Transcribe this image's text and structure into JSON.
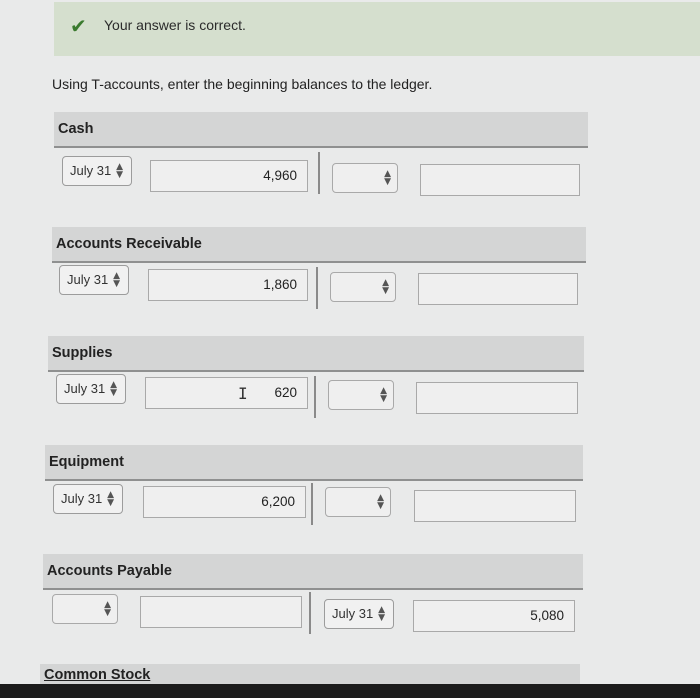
{
  "banner": {
    "check_icon": "checkmark-icon",
    "message": "Your answer is correct."
  },
  "instruction": "Using T-accounts, enter the beginning balances to the ledger.",
  "arrow_glyph": "▲▼",
  "accounts": [
    {
      "name": "Cash",
      "debit_date": "July 31",
      "debit_amount": "4,960",
      "credit_date": "",
      "credit_amount": ""
    },
    {
      "name": "Accounts Receivable",
      "debit_date": "July 31",
      "debit_amount": "1,860",
      "credit_date": "",
      "credit_amount": ""
    },
    {
      "name": "Supplies",
      "debit_date": "July 31",
      "debit_amount": "620",
      "credit_date": "",
      "credit_amount": ""
    },
    {
      "name": "Equipment",
      "debit_date": "July 31",
      "debit_amount": "6,200",
      "credit_date": "",
      "credit_amount": ""
    },
    {
      "name": "Accounts Payable",
      "debit_date": "",
      "debit_amount": "",
      "credit_date": "July 31",
      "credit_amount": "5,080"
    },
    {
      "name": "Common Stock"
    }
  ]
}
